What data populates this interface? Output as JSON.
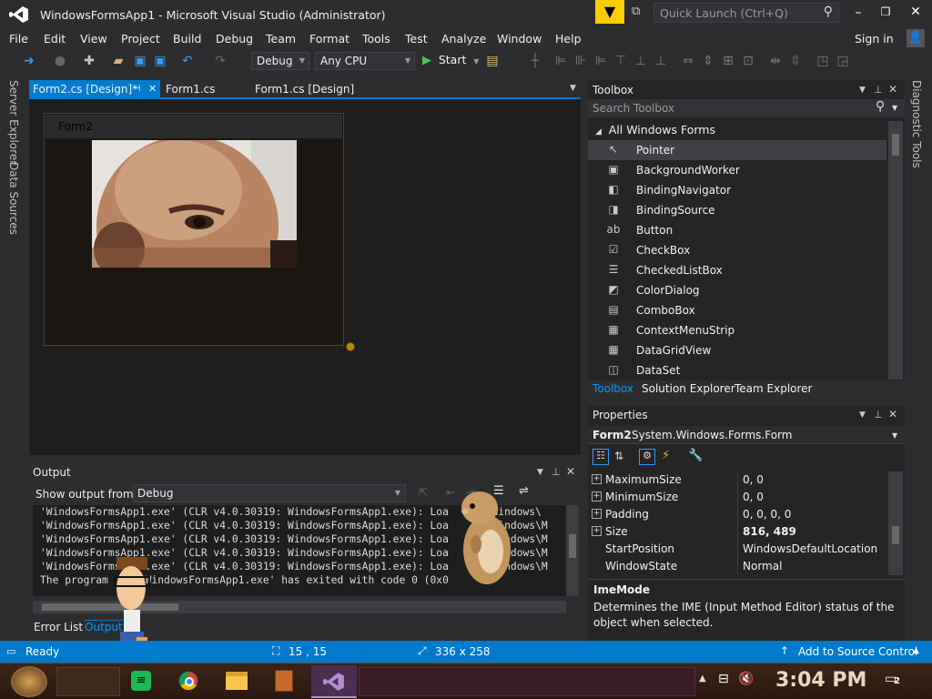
{
  "title_bar": {
    "title": "WindowsFormsApp1 - Microsoft Visual Studio  (Administrator)",
    "quick_launch_placeholder": "Quick Launch (Ctrl+Q)"
  },
  "menu": [
    "File",
    "Edit",
    "View",
    "Project",
    "Build",
    "Debug",
    "Team",
    "Format",
    "Tools",
    "Test",
    "Analyze",
    "Window",
    "Help"
  ],
  "sign_in": "Sign in",
  "toolbar": {
    "config": "Debug",
    "platform": "Any CPU",
    "start": "Start"
  },
  "side_tabs_left": [
    "Server Explorer",
    "Data Sources"
  ],
  "side_tabs_right": [
    "Diagnostic Tools"
  ],
  "doc_tabs": [
    {
      "label": "Form2.cs [Design]*",
      "active": true
    },
    {
      "label": "Form1.cs",
      "active": false
    },
    {
      "label": "Form1.cs [Design]",
      "active": false
    }
  ],
  "designer": {
    "form_title": "Form2"
  },
  "output": {
    "title": "Output",
    "show_from_label": "Show output from:",
    "show_from_value": "Debug",
    "lines": [
      "'WindowsFormsApp1.exe' (CLR v4.0.30319: WindowsFormsApp1.exe): Loa      \\Windows\\",
      "'WindowsFormsApp1.exe' (CLR v4.0.30319: WindowsFormsApp1.exe): Loa      \\Windows\\M",
      "'WindowsFormsApp1.exe' (CLR v4.0.30319: WindowsFormsApp1.exe): Loa      \\Windows\\M",
      "'WindowsFormsApp1.exe' (CLR v4.0.30319: WindowsFormsApp1.exe): Loa      \\Windows\\M",
      "'WindowsFormsApp1.exe' (CLR v4.0.30319: WindowsFormsApp1.exe): Loa      \\Windows\\M",
      "The program    ] WindowsFormsApp1.exe' has exited with code 0 (0x0"
    ],
    "tabs": [
      "Error List",
      "Output"
    ]
  },
  "toolbox": {
    "title": "Toolbox",
    "search_placeholder": "Search Toolbox",
    "group": "All Windows Forms",
    "items": [
      {
        "label": "Pointer",
        "icon": "pointer-icon",
        "glyph": "↖"
      },
      {
        "label": "BackgroundWorker",
        "icon": "background-worker-icon",
        "glyph": "▣"
      },
      {
        "label": "BindingNavigator",
        "icon": "binding-navigator-icon",
        "glyph": "◧"
      },
      {
        "label": "BindingSource",
        "icon": "binding-source-icon",
        "glyph": "◨"
      },
      {
        "label": "Button",
        "icon": "button-icon",
        "glyph": "ab"
      },
      {
        "label": "CheckBox",
        "icon": "checkbox-icon",
        "glyph": "☑"
      },
      {
        "label": "CheckedListBox",
        "icon": "checked-list-box-icon",
        "glyph": "☰"
      },
      {
        "label": "ColorDialog",
        "icon": "color-dialog-icon",
        "glyph": "◩"
      },
      {
        "label": "ComboBox",
        "icon": "combobox-icon",
        "glyph": "▤"
      },
      {
        "label": "ContextMenuStrip",
        "icon": "context-menu-strip-icon",
        "glyph": "▦"
      },
      {
        "label": "DataGridView",
        "icon": "data-grid-view-icon",
        "glyph": "▦"
      },
      {
        "label": "DataSet",
        "icon": "dataset-icon",
        "glyph": "◫"
      }
    ],
    "bottom_tabs": [
      "Toolbox",
      "Solution Explorer",
      "Team Explorer"
    ]
  },
  "properties": {
    "title": "Properties",
    "object_name": "Form2",
    "object_type": "System.Windows.Forms.Form",
    "rows": [
      {
        "name": "MaximumSize",
        "value": "0, 0",
        "expand": true
      },
      {
        "name": "MinimumSize",
        "value": "0, 0",
        "expand": true
      },
      {
        "name": "Padding",
        "value": "0, 0, 0, 0",
        "expand": true
      },
      {
        "name": "Size",
        "value": "816, 489",
        "expand": true
      },
      {
        "name": "StartPosition",
        "value": "WindowsDefaultLocation",
        "expand": false
      },
      {
        "name": "WindowState",
        "value": "Normal",
        "expand": false
      }
    ],
    "desc_title": "ImeMode",
    "desc_text": "Determines the IME (Input Method Editor) status of the object when selected."
  },
  "status": {
    "ready": "Ready",
    "position": "15 , 15",
    "size": "336 x 258",
    "source_control": "Add to Source Control"
  },
  "taskbar": {
    "clock": "3:04 PM",
    "notification_count": "2"
  },
  "colors": {
    "accent": "#007acc",
    "vs_purple": "#865fc5",
    "background": "#2d2d30"
  }
}
